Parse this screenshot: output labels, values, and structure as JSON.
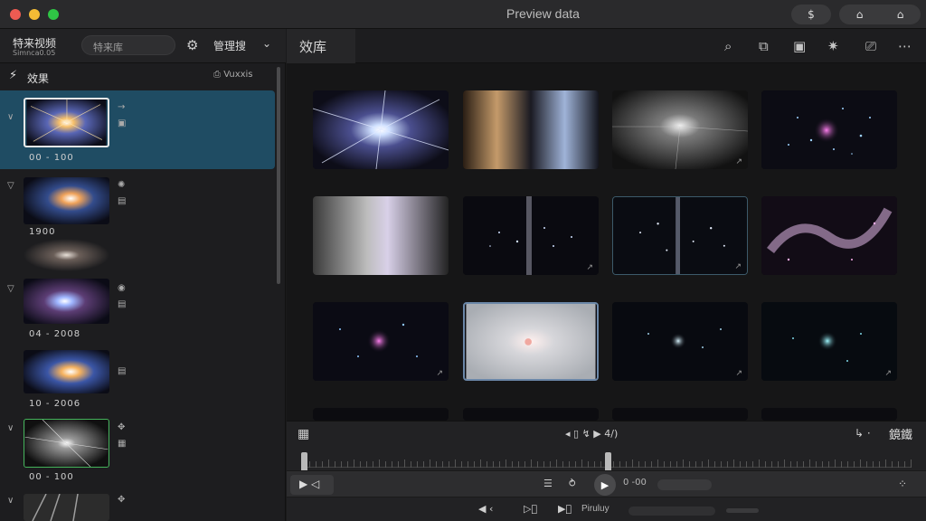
{
  "window": {
    "title": "Preview data",
    "pill1": "$",
    "pill2_icons": [
      "⌂",
      "⌂"
    ]
  },
  "left_header": {
    "library_name": "特来视频",
    "library_sub": "Simnca0.05",
    "search_placeholder": "特来库",
    "manage_label": "管理搜",
    "manage_chevron": "⌄"
  },
  "sidebar": {
    "title": "效果",
    "import_label": "Vuxxis",
    "items": [
      {
        "range": "00 - 100",
        "side_icons": [
          "→",
          "▣"
        ]
      },
      {
        "range": "1900",
        "side_icons": [
          "✺",
          "▤"
        ]
      },
      {
        "range": "04 - 2008",
        "side_icons": [
          "◉",
          "▤"
        ]
      },
      {
        "range": "10 - 2006",
        "side_icons": [
          "▤"
        ]
      },
      {
        "range": "00 - 100",
        "side_icons": [
          "✥",
          "▦"
        ]
      }
    ]
  },
  "main": {
    "tab_label": "效库",
    "toolbar_icons": [
      "search-icon",
      "split-icon",
      "clip-icon",
      "effects-icon",
      "caption-icon",
      "more-icon"
    ],
    "tile_badge": "↗"
  },
  "timeline": {
    "center_controls": "◂ ▯ ↯ ▶ 4/)",
    "right_icon": "↳ ·",
    "right_label": "鏡鐵",
    "timecode": "0 -00",
    "bottom_label": "Piruluy"
  },
  "colors": {
    "accent": "#1f4c63",
    "selection_border": "#6b87a8",
    "green_border": "#44b35a"
  }
}
